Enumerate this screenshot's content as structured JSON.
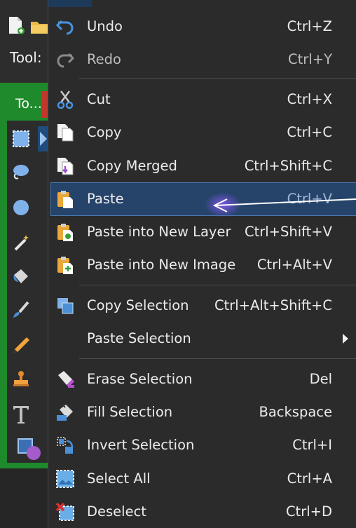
{
  "app": {
    "tool_label": "Tool:",
    "tools_tab": "To..."
  },
  "menu": {
    "items": [
      {
        "label": "Undo",
        "shortcut": "Ctrl+Z",
        "icon": "undo-icon"
      },
      {
        "label": "Redo",
        "shortcut": "Ctrl+Y",
        "icon": "redo-icon",
        "disabled": true
      },
      {
        "label": "Cut",
        "shortcut": "Ctrl+X",
        "icon": "scissors-icon"
      },
      {
        "label": "Copy",
        "shortcut": "Ctrl+C",
        "icon": "copy-icon"
      },
      {
        "label": "Copy Merged",
        "shortcut": "Ctrl+Shift+C",
        "icon": "copy-merged-icon"
      },
      {
        "label": "Paste",
        "shortcut": "Ctrl+V",
        "icon": "paste-icon",
        "highlighted": true
      },
      {
        "label": "Paste into New Layer",
        "shortcut": "Ctrl+Shift+V",
        "icon": "paste-new-layer-icon"
      },
      {
        "label": "Paste into New Image",
        "shortcut": "Ctrl+Alt+V",
        "icon": "paste-new-image-icon"
      },
      {
        "label": "Copy Selection",
        "shortcut": "Ctrl+Alt+Shift+C",
        "icon": "copy-selection-icon"
      },
      {
        "label": "Paste Selection",
        "shortcut": "",
        "icon": "submenu-arrow-icon",
        "submenu": true
      },
      {
        "label": "Erase Selection",
        "shortcut": "Del",
        "icon": "eraser-icon"
      },
      {
        "label": "Fill Selection",
        "shortcut": "Backspace",
        "icon": "fill-bucket-icon"
      },
      {
        "label": "Invert Selection",
        "shortcut": "Ctrl+I",
        "icon": "invert-selection-icon"
      },
      {
        "label": "Select All",
        "shortcut": "Ctrl+A",
        "icon": "select-all-icon"
      },
      {
        "label": "Deselect",
        "shortcut": "Ctrl+D",
        "icon": "deselect-icon"
      }
    ]
  },
  "colors": {
    "menu_bg": "#2b2b2b",
    "highlight": "#26436a",
    "panel_green": "#1f8a2b",
    "annotation": "#ffffff"
  }
}
